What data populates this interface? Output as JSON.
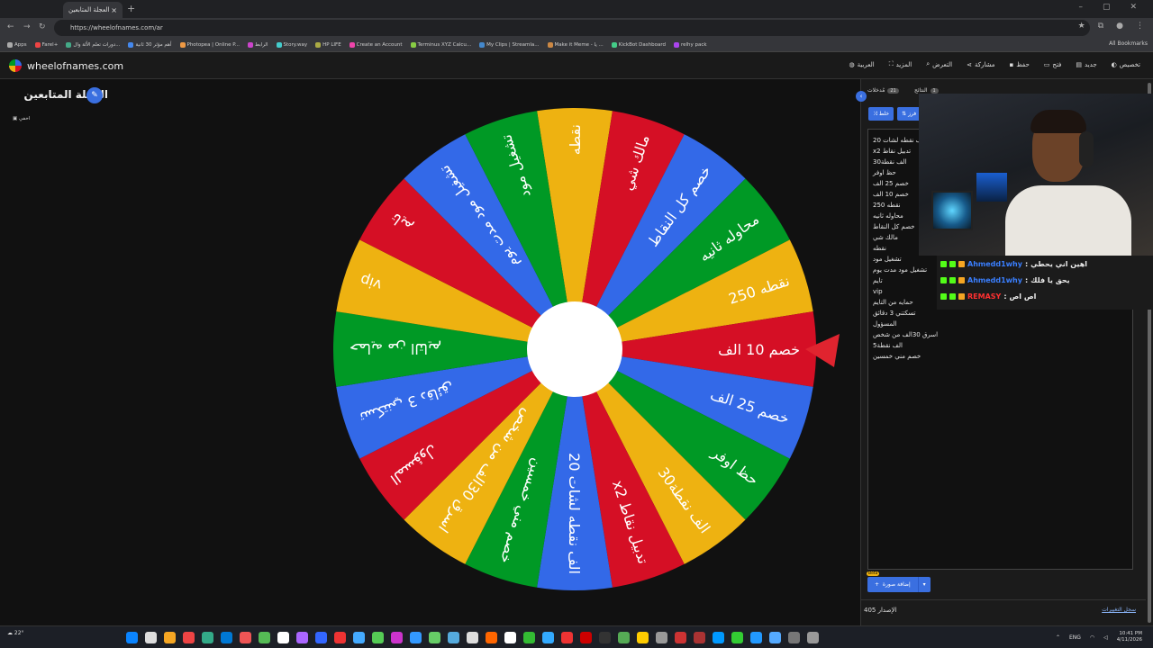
{
  "browser": {
    "tab_title": "العجلة المتابعين",
    "url": "https://wheelofnames.com/ar",
    "bookmarks": [
      "Apps",
      "Farel+",
      "دورات تعلم الألة وال...",
      "أهم مؤثر 30 ثانية",
      "Photopea | Online P...",
      "الرابط",
      "Story.way",
      "HP LIFE",
      "Create an Account",
      "Terminus XYZ Calcu...",
      "My Clips | Streamla...",
      "Make it Meme - يا ...",
      "KickBot Dashboard",
      "relhy pack"
    ],
    "all_bookmarks": "All Bookmarks"
  },
  "site": {
    "logo_text": "wheelofnames.com",
    "menu": [
      "تخصيص",
      "جديد",
      "فتح",
      "حفظ",
      "مشاركة",
      "التعرض",
      "المزيد",
      "العربية"
    ]
  },
  "wheel": {
    "title": "العجلة المتابعين",
    "hide_label": "اخفي",
    "slices": [
      {
        "label": "نقطه",
        "color": "#eeb211"
      },
      {
        "label": "مالك شي",
        "color": "#d50f25"
      },
      {
        "label": "خصم كل النقاط",
        "color": "#3369e8"
      },
      {
        "label": "محاوله ثانيه",
        "color": "#009925"
      },
      {
        "label": "نقطه 250",
        "color": "#eeb211"
      },
      {
        "label": "خصم 10 الف",
        "color": "#d50f25"
      },
      {
        "label": "خصم 25 الف",
        "color": "#3369e8"
      },
      {
        "label": "حظ اوفر",
        "color": "#009925"
      },
      {
        "label": "الف نقطة30",
        "color": "#eeb211"
      },
      {
        "label": "x2 تدبيل نقاط",
        "color": "#d50f25"
      },
      {
        "label": "الف نقطه لشات 20",
        "color": "#3369e8"
      },
      {
        "label": "خصم مني خمسين",
        "color": "#009925"
      },
      {
        "label": "اسرق 30الف من شخص",
        "color": "#eeb211"
      },
      {
        "label": "المسؤول",
        "color": "#d50f25"
      },
      {
        "label": "تسكتني 3 دقائق",
        "color": "#3369e8"
      },
      {
        "label": "حمايه من التايم",
        "color": "#009925"
      },
      {
        "label": "vip",
        "color": "#eeb211"
      },
      {
        "label": "تايم",
        "color": "#d50f25"
      },
      {
        "label": "تشغيل مود مدت يوم",
        "color": "#3369e8"
      },
      {
        "label": "تشغيل مود",
        "color": "#009925"
      }
    ]
  },
  "panel": {
    "tab_entries": "مُدخلات",
    "tab_entries_count": "21",
    "tab_results": "النتائج",
    "tab_results_count": "1",
    "shuffle_label": "خلط",
    "sort_label": "فرز",
    "entries": [
      "الف نقطه لشات 20",
      "x2 تدبيل نقاط",
      "الف نقطة30",
      "حظ اوفر",
      "خصم 25 الف",
      "خصم 10 الف",
      "نقطه 250",
      "محاوله ثانيه",
      "خصم كل النقاط",
      "مالك شي",
      "نقطه",
      "تشغيل مود",
      "تشغيل مود مدت يوم",
      "تايم",
      "vip",
      "حمايه من التايم",
      "تسكتني 3 دقائق",
      "المسؤول",
      "اسرق 30الف من شخص",
      "الف نقطة5",
      "خصم مني خمسين"
    ],
    "add_image_label": "إضافة صورة",
    "beta_label": "Beta",
    "version": "الإصدار 405",
    "changelog": "سجل التغييرات"
  },
  "chat": [
    {
      "user": "Ahmedd1why",
      "message": "اهين اني يحطي",
      "color": "#3a7fff"
    },
    {
      "user": "Ahmedd1why",
      "message": "يحق يا فلك",
      "color": "#3a7fff"
    },
    {
      "user": "REMASY",
      "message": "اص اص",
      "color": "#ff3030"
    }
  ],
  "taskbar": {
    "temp": "22°",
    "lang": "ENG",
    "time": "10:41 PM",
    "date": "4/11/2026"
  }
}
